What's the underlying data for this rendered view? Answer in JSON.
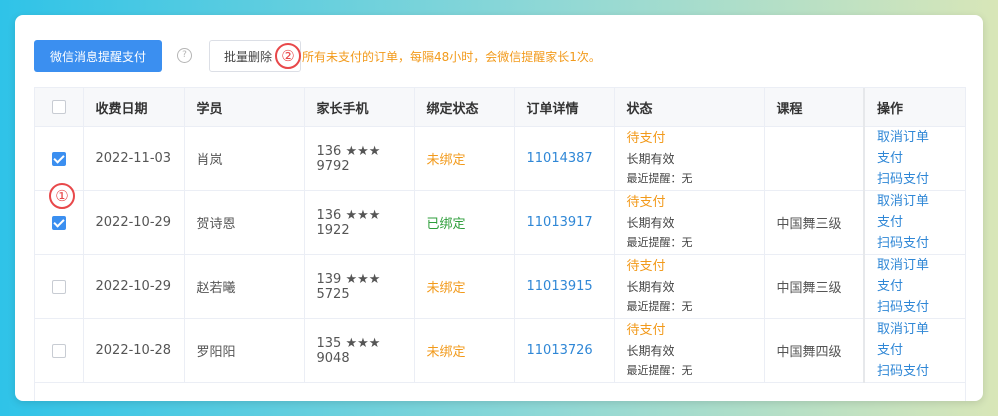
{
  "toolbar": {
    "wechat_pay_label": "微信消息提醒支付",
    "help_icon": "?",
    "batch_delete_label": "批量删除",
    "notice": "所有未支付的订单，每隔48小时，会微信提醒家长1次。"
  },
  "markers": {
    "one": "①",
    "two": "②"
  },
  "table": {
    "headers": {
      "date": "收费日期",
      "student": "学员",
      "phone": "家长手机",
      "bind": "绑定状态",
      "order": "订单详情",
      "status": "状态",
      "course": "课程",
      "ops": "操作"
    },
    "rows": [
      {
        "checked": true,
        "date": "2022-11-03",
        "student": "肖岚",
        "phone": "136 ★★★ 9792",
        "bind": "未绑定",
        "bind_state": "unbound",
        "order": "11014387",
        "status": "待支付",
        "validity": "长期有效",
        "reminder": "最近提醒：无",
        "course": "",
        "op_cancel": "取消订单",
        "op_pay": "支付",
        "op_scan": "扫码支付"
      },
      {
        "checked": true,
        "date": "2022-10-29",
        "student": "贺诗恩",
        "phone": "136 ★★★ 1922",
        "bind": "已绑定",
        "bind_state": "bound",
        "order": "11013917",
        "status": "待支付",
        "validity": "长期有效",
        "reminder": "最近提醒：无",
        "course": "中国舞三级",
        "op_cancel": "取消订单",
        "op_pay": "支付",
        "op_scan": "扫码支付"
      },
      {
        "checked": false,
        "date": "2022-10-29",
        "student": "赵若曦",
        "phone": "139 ★★★ 5725",
        "bind": "未绑定",
        "bind_state": "unbound",
        "order": "11013915",
        "status": "待支付",
        "validity": "长期有效",
        "reminder": "最近提醒：无",
        "course": "中国舞三级",
        "op_cancel": "取消订单",
        "op_pay": "支付",
        "op_scan": "扫码支付"
      },
      {
        "checked": false,
        "date": "2022-10-28",
        "student": "罗阳阳",
        "phone": "135 ★★★ 9048",
        "bind": "未绑定",
        "bind_state": "unbound",
        "order": "11013726",
        "status": "待支付",
        "validity": "长期有效",
        "reminder": "最近提醒：无",
        "course": "中国舞四级",
        "op_cancel": "取消订单",
        "op_pay": "支付",
        "op_scan": "扫码支付"
      }
    ]
  },
  "colors": {
    "primary": "#3b8ff0",
    "warning": "#f29a1b",
    "success": "#2e9e3b",
    "link": "#2f87d6",
    "marker": "#e8484a"
  }
}
